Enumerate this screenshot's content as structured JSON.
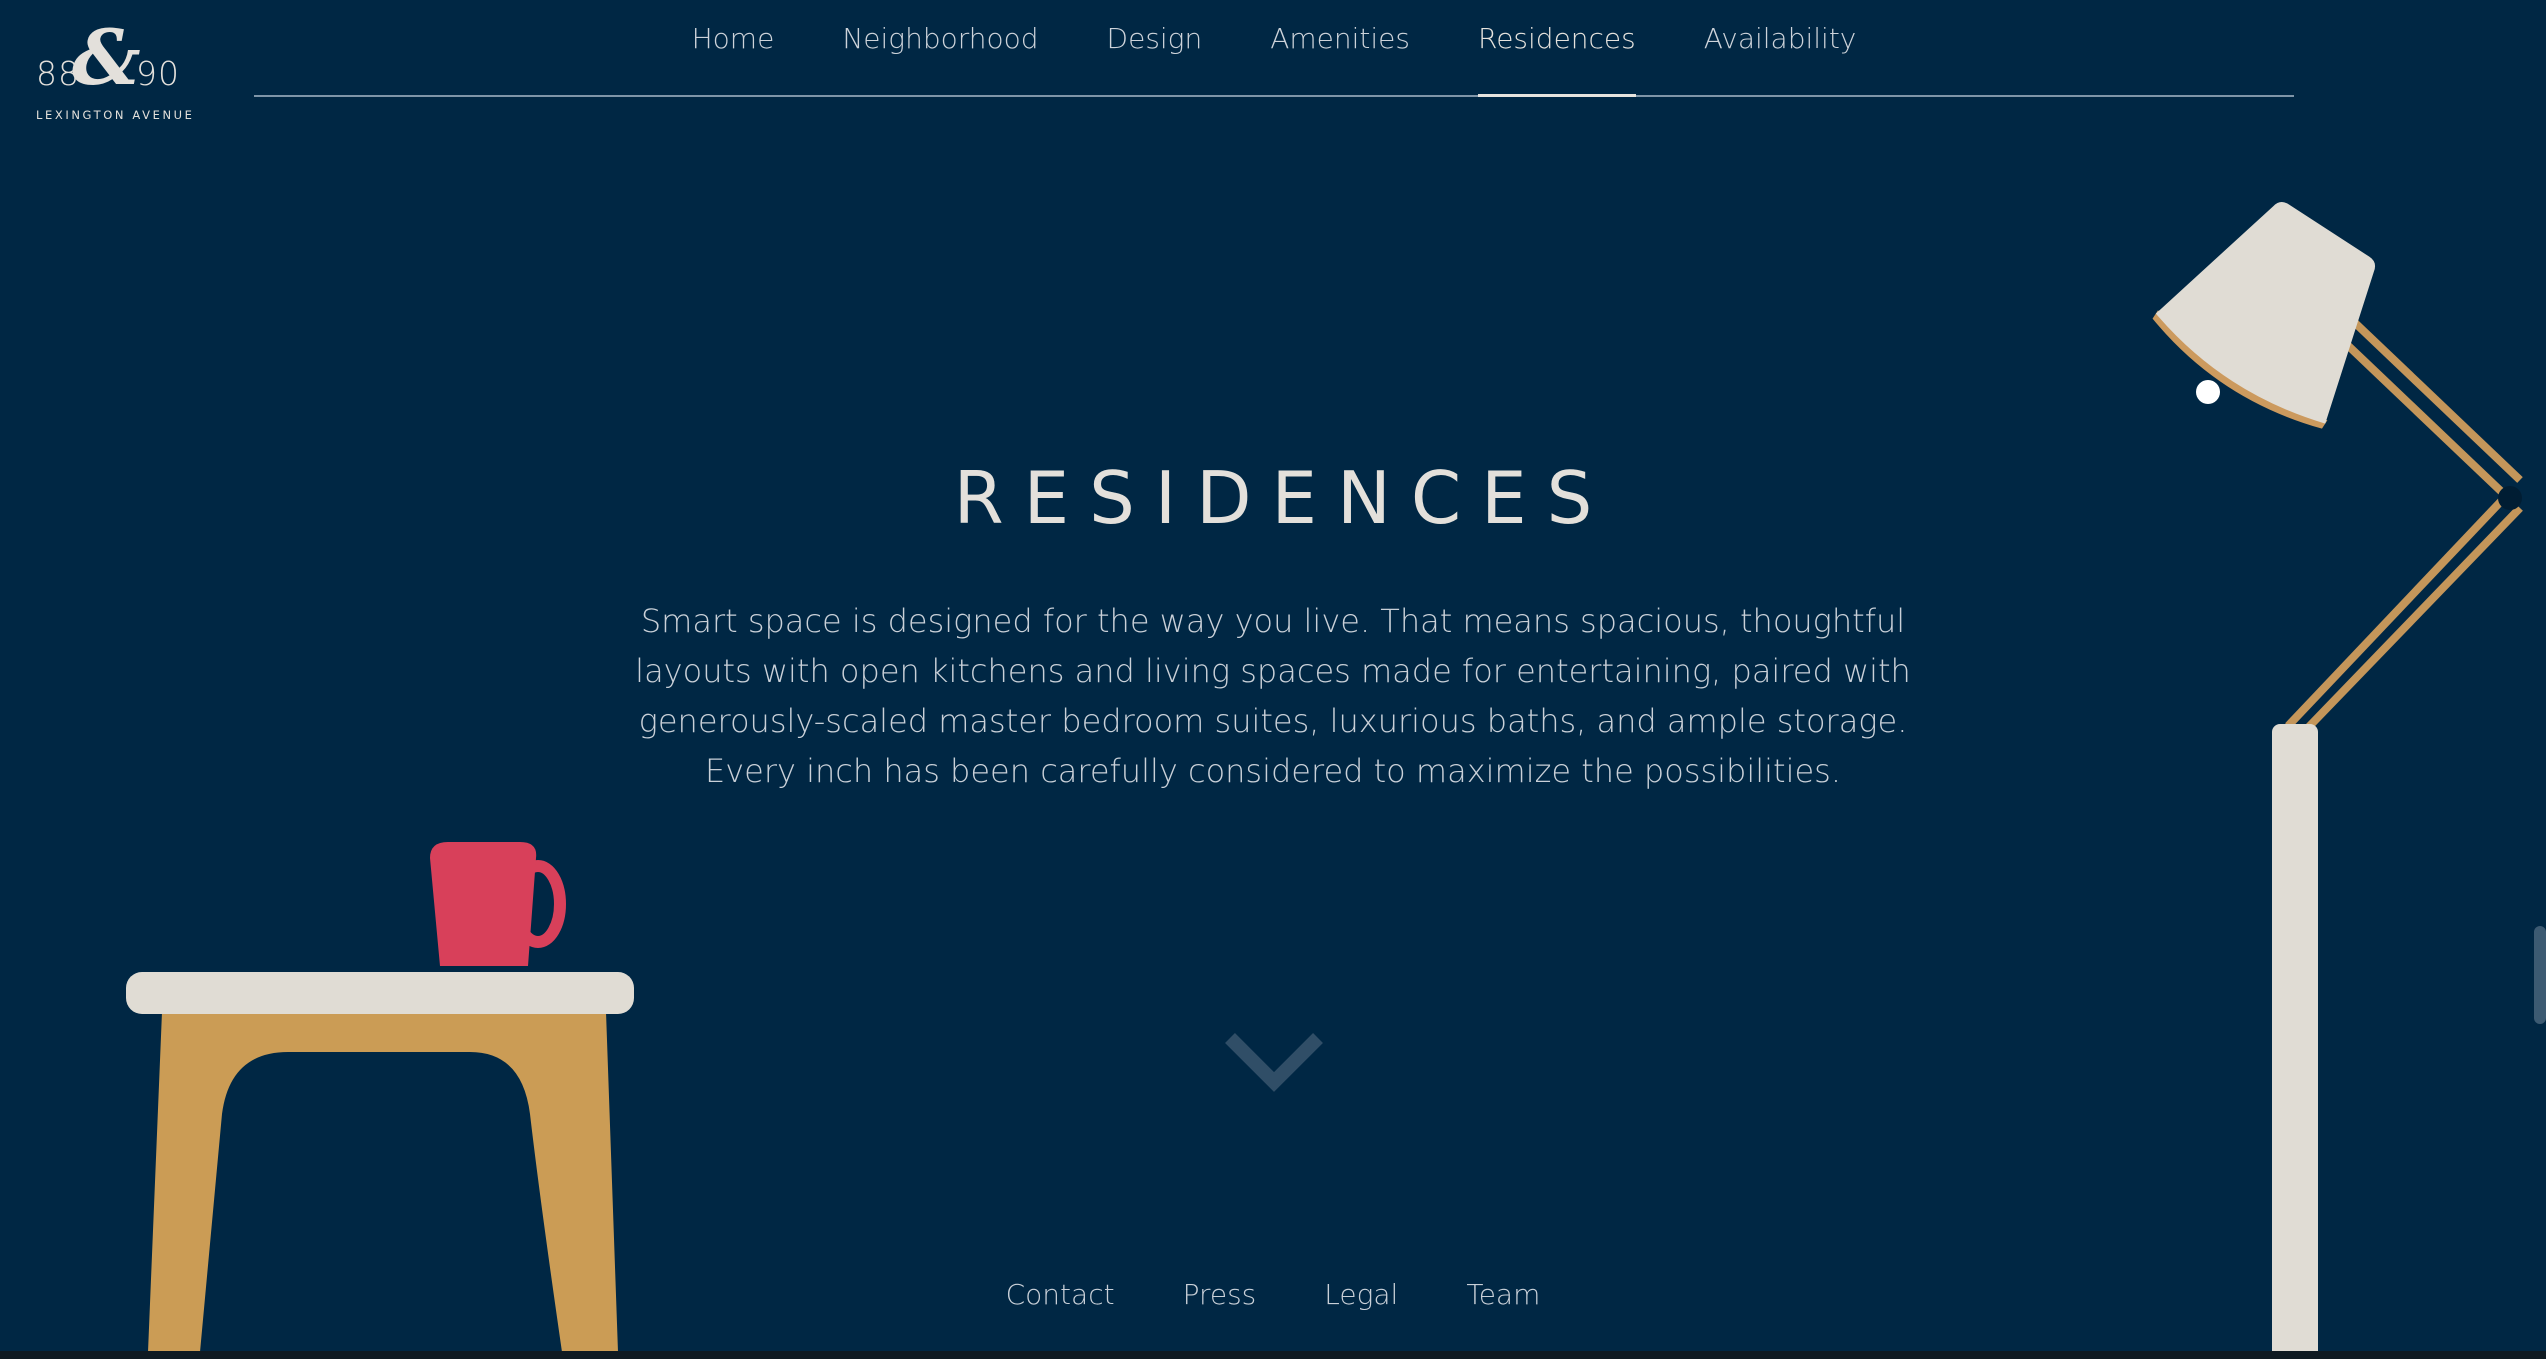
{
  "logo": {
    "left_number": "88",
    "ampersand": "&",
    "right_number": "90",
    "subtitle": "LEXINGTON AVENUE"
  },
  "nav": {
    "items": [
      {
        "label": "Home"
      },
      {
        "label": "Neighborhood"
      },
      {
        "label": "Design"
      },
      {
        "label": "Amenities"
      },
      {
        "label": "Residences",
        "active": true
      },
      {
        "label": "Availability"
      }
    ]
  },
  "hero": {
    "title": "RESIDENCES",
    "description": "Smart space is designed for the way you live. That means spacious, thoughtful layouts with open kitchens and living spaces made for entertaining, paired with generously-scaled master bedroom suites, luxurious baths, and ample storage. Every inch has been carefully considered to maximize the possibilities."
  },
  "scroll_indicator": {
    "icon": "chevron-down-icon"
  },
  "footer": {
    "links": [
      "Contact",
      "Press",
      "Legal",
      "Team"
    ]
  },
  "colors": {
    "background": "#002744",
    "text_light": "#e3e0db",
    "wood": "#cb9c55",
    "cream": "#e0dcd4",
    "mug": "#d8405a"
  }
}
